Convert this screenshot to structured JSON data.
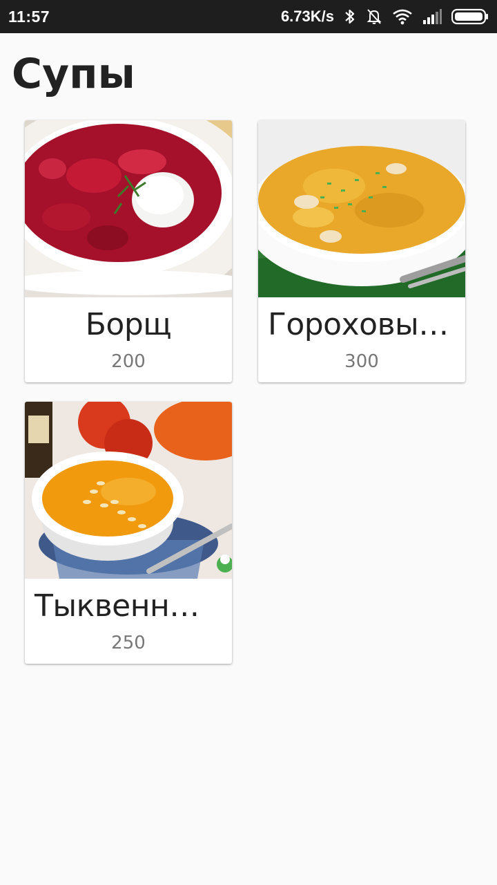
{
  "status_bar": {
    "time": "11:57",
    "net_speed": "6.73K/s",
    "icons": [
      "bluetooth-icon",
      "notifications-off-icon",
      "wifi-icon",
      "signal-icon",
      "battery-icon"
    ]
  },
  "page": {
    "title": "Супы"
  },
  "items": [
    {
      "name": "Борщ",
      "price": "200",
      "image": "borscht-photo"
    },
    {
      "name": "Гороховый суп",
      "price": "300",
      "image": "pea-soup-photo"
    },
    {
      "name": "Тыквенный суп",
      "price": "250",
      "image": "pumpkin-soup-photo"
    }
  ],
  "colors": {
    "status_bar_bg": "#1e1e1e",
    "page_bg": "#fafafa",
    "card_bg": "#ffffff",
    "title_text": "#222222",
    "price_text": "#777777"
  }
}
